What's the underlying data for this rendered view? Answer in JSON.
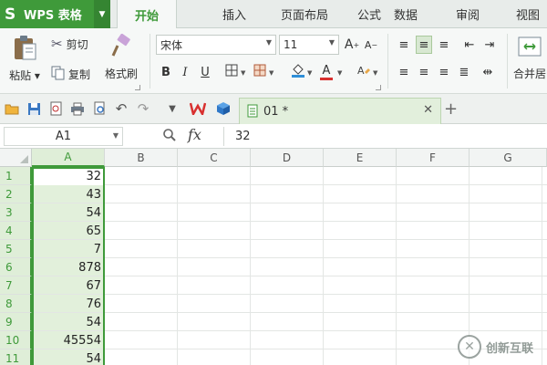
{
  "app": {
    "name": "WPS 表格",
    "logo_letter": "S"
  },
  "tabs": [
    {
      "label": "开始",
      "active": true
    },
    {
      "label": "插入"
    },
    {
      "label": "页面布局"
    },
    {
      "label": "公式"
    },
    {
      "label": "数据"
    },
    {
      "label": "审阅"
    },
    {
      "label": "视图"
    }
  ],
  "ribbon": {
    "paste_label": "粘贴",
    "cut_label": "剪切",
    "copy_label": "复制",
    "format_painter_label": "格式刷",
    "font_name": "宋体",
    "font_size": "11",
    "bold": "B",
    "italic": "I",
    "underline": "U",
    "font_color_glyph": "A",
    "increase_font": "A",
    "decrease_font": "A",
    "merge_label": "合并居"
  },
  "document_tab": {
    "title": "01 *"
  },
  "formula_bar": {
    "name_box": "A1",
    "fx": "fx",
    "value": "32"
  },
  "sheet": {
    "columns": [
      "A",
      "B",
      "C",
      "D",
      "E",
      "F",
      "G"
    ],
    "selected_column": "A",
    "rows": [
      {
        "num": "1",
        "a": "32"
      },
      {
        "num": "2",
        "a": "43"
      },
      {
        "num": "3",
        "a": "54"
      },
      {
        "num": "4",
        "a": "65"
      },
      {
        "num": "5",
        "a": "7"
      },
      {
        "num": "6",
        "a": "878"
      },
      {
        "num": "7",
        "a": "67"
      },
      {
        "num": "8",
        "a": "76"
      },
      {
        "num": "9",
        "a": "54"
      },
      {
        "num": "10",
        "a": "45554"
      },
      {
        "num": "11",
        "a": "54"
      }
    ]
  },
  "watermark": {
    "text": "创新互联"
  },
  "colors": {
    "accent": "#3f9a3a",
    "selection_fill": "#e2f0db",
    "ribbon_bg": "#f6f8f7"
  }
}
